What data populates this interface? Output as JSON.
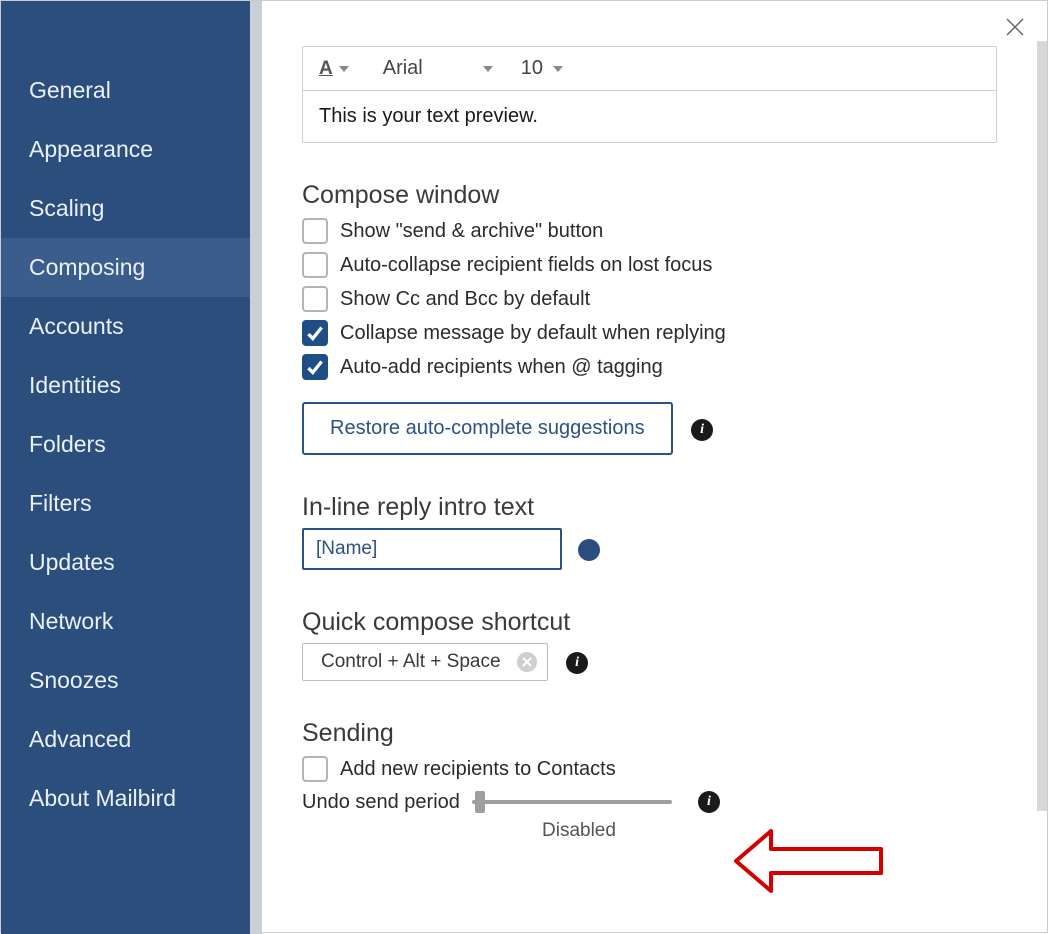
{
  "sidebar": {
    "items": [
      {
        "label": "General"
      },
      {
        "label": "Appearance"
      },
      {
        "label": "Scaling"
      },
      {
        "label": "Composing"
      },
      {
        "label": "Accounts"
      },
      {
        "label": "Identities"
      },
      {
        "label": "Folders"
      },
      {
        "label": "Filters"
      },
      {
        "label": "Updates"
      },
      {
        "label": "Network"
      },
      {
        "label": "Snoozes"
      },
      {
        "label": "Advanced"
      },
      {
        "label": "About Mailbird"
      }
    ],
    "active_index": 3
  },
  "font_toolbar": {
    "font_family": "Arial",
    "font_size": "10",
    "preview_text": "This is your text preview."
  },
  "compose_window": {
    "title": "Compose window",
    "options": [
      {
        "label": "Show \"send & archive\" button",
        "checked": false
      },
      {
        "label": "Auto-collapse recipient fields on lost focus",
        "checked": false
      },
      {
        "label": "Show Cc and Bcc by default",
        "checked": false
      },
      {
        "label": "Collapse message by default when replying",
        "checked": true
      },
      {
        "label": "Auto-add recipients when @ tagging",
        "checked": true
      }
    ],
    "restore_button": "Restore auto-complete suggestions"
  },
  "inline_reply": {
    "title": "In-line reply intro text",
    "value": "[Name]",
    "color": "#2b4d7d"
  },
  "quick_compose": {
    "title": "Quick compose shortcut",
    "value": "Control + Alt + Space"
  },
  "sending": {
    "title": "Sending",
    "add_recipients_label": "Add new recipients to Contacts",
    "add_recipients_checked": false,
    "undo_label": "Undo send period",
    "undo_value_label": "Disabled"
  }
}
